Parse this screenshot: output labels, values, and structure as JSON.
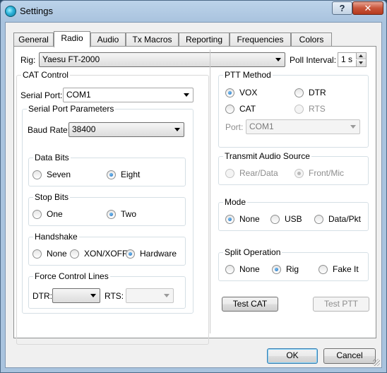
{
  "window": {
    "title": "Settings",
    "help_label": "?",
    "close_label": "✕"
  },
  "tabs": [
    "General",
    "Radio",
    "Audio",
    "Tx Macros",
    "Reporting",
    "Frequencies",
    "Colors"
  ],
  "active_tab": "Radio",
  "rig": {
    "label": "Rig:",
    "value": "Yaesu FT-2000"
  },
  "poll": {
    "label": "Poll Interval:",
    "value": "1 s"
  },
  "cat": {
    "title": "CAT Control",
    "serial_port_label": "Serial Port:",
    "serial_port_value": "COM1",
    "params_title": "Serial Port Parameters",
    "baud_label": "Baud Rate:",
    "baud_value": "38400",
    "data_bits": {
      "title": "Data Bits",
      "options": [
        "Seven",
        "Eight"
      ],
      "selected": "Eight"
    },
    "stop_bits": {
      "title": "Stop Bits",
      "options": [
        "One",
        "Two"
      ],
      "selected": "Two"
    },
    "handshake": {
      "title": "Handshake",
      "options": [
        "None",
        "XON/XOFF",
        "Hardware"
      ],
      "selected": "Hardware"
    },
    "force": {
      "title": "Force Control Lines",
      "dtr_label": "DTR:",
      "dtr_value": "",
      "rts_label": "RTS:",
      "rts_value": ""
    }
  },
  "ptt": {
    "title": "PTT Method",
    "options": [
      "VOX",
      "DTR",
      "CAT",
      "RTS"
    ],
    "selected": "VOX",
    "port_label": "Port:",
    "port_value": "COM1"
  },
  "tx_audio": {
    "title": "Transmit Audio Source",
    "options": [
      "Rear/Data",
      "Front/Mic"
    ],
    "selected": "Front/Mic"
  },
  "mode": {
    "title": "Mode",
    "options": [
      "None",
      "USB",
      "Data/Pkt"
    ],
    "selected": "None"
  },
  "split": {
    "title": "Split Operation",
    "options": [
      "None",
      "Rig",
      "Fake It"
    ],
    "selected": "Rig"
  },
  "buttons": {
    "test_cat": "Test CAT",
    "test_ptt": "Test PTT",
    "ok": "OK",
    "cancel": "Cancel"
  },
  "icons": {
    "app": "wsjt-app-icon",
    "dropdown": "chevron-down-icon"
  },
  "colors": {
    "titlebar": "#a9c3de",
    "close": "#c9553a",
    "radio_checked": "#1b67b8"
  }
}
